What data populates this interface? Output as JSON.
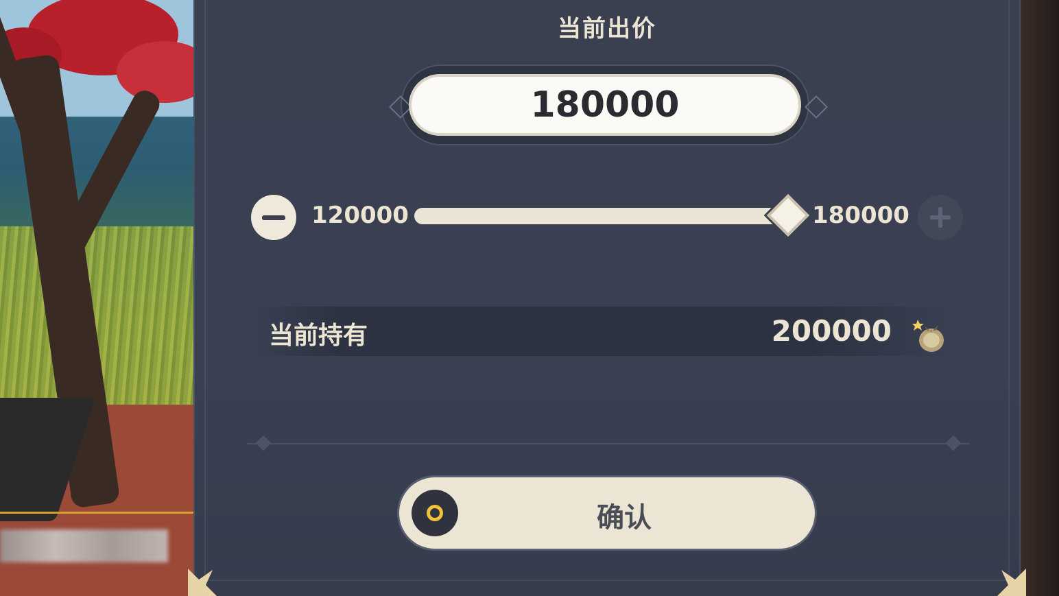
{
  "bid_panel": {
    "title": "当前出价",
    "current_bid": "180000",
    "slider": {
      "min_label": "120000",
      "max_label": "180000",
      "min_value": 120000,
      "max_value": 180000,
      "value": 180000
    },
    "holding": {
      "label": "当前持有",
      "value": "200000",
      "currency_icon": "mora-bag-icon"
    },
    "confirm_label": "确认"
  },
  "colors": {
    "panel_bg": "#394052",
    "cream": "#ece5d3",
    "accent_gold": "#f0c23a"
  }
}
